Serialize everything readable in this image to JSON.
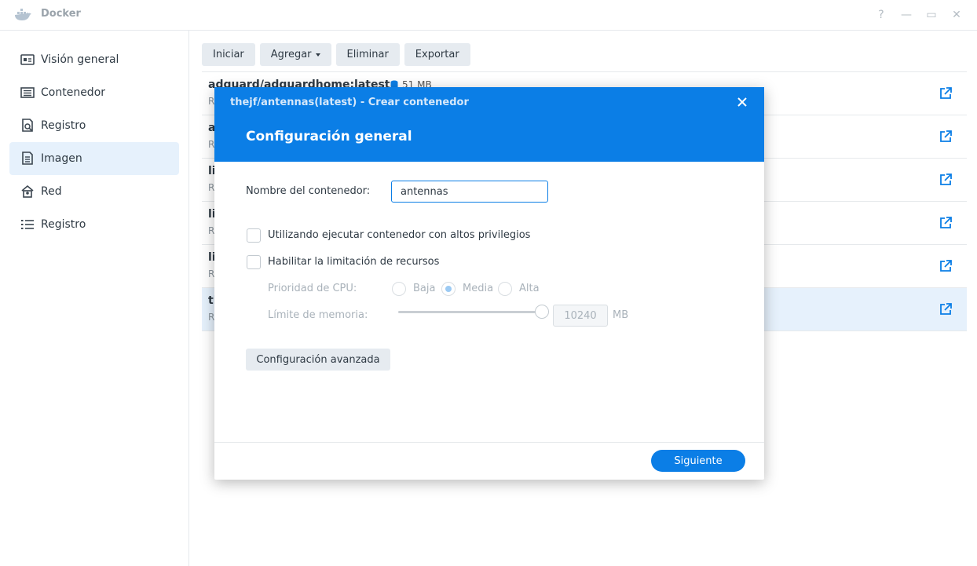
{
  "window": {
    "title": "Docker",
    "help_glyph": "?",
    "minimize_glyph": "—",
    "maximize_glyph": "▭",
    "close_glyph": "✕"
  },
  "sidebar": {
    "items": [
      {
        "label": "Visión general",
        "icon": "overview-icon",
        "active": false
      },
      {
        "label": "Contenedor",
        "icon": "container-icon",
        "active": false
      },
      {
        "label": "Registro",
        "icon": "registry-search-icon",
        "active": false
      },
      {
        "label": "Imagen",
        "icon": "image-icon",
        "active": true
      },
      {
        "label": "Red",
        "icon": "network-icon",
        "active": false
      },
      {
        "label": "Registro",
        "icon": "log-list-icon",
        "active": false
      }
    ]
  },
  "toolbar": {
    "start_label": "Iniciar",
    "add_label": "Agregar",
    "delete_label": "Eliminar",
    "export_label": "Exportar"
  },
  "image_list": {
    "rows": [
      {
        "name": "adguard/adguardhome:latest",
        "size": "51 MB",
        "sub": "R"
      },
      {
        "name": "a",
        "sub": "R"
      },
      {
        "name": "li",
        "sub": "R"
      },
      {
        "name": "li",
        "sub": "R"
      },
      {
        "name": "li",
        "sub": "R"
      },
      {
        "name": "tl",
        "sub": "R",
        "selected": true
      }
    ]
  },
  "dialog": {
    "title": "thejf/antennas(latest) - Crear contenedor",
    "subtitle": "Configuración general",
    "container_name_label": "Nombre del contenedor:",
    "container_name_value": "antennas",
    "privileged_label": "Utilizando ejecutar contenedor con altos privilegios",
    "privileged_checked": false,
    "resource_limit_label": "Habilitar la limitación de recursos",
    "resource_limit_checked": false,
    "cpu_priority_label": "Prioridad de CPU:",
    "cpu_options": [
      "Baja",
      "Media",
      "Alta"
    ],
    "cpu_selected": "Media",
    "memory_limit_label": "Límite de memoria:",
    "memory_slider_level": 1.0,
    "memory_value": "10240",
    "memory_unit": "MB",
    "advanced_button": "Configuración avanzada",
    "next_button": "Siguiente"
  },
  "colors": {
    "accent": "#0b7ee6",
    "sidebar_active_bg": "#e6f1fc",
    "button_bg": "#e6ebf0",
    "disabled_text": "#a9b2ba"
  }
}
